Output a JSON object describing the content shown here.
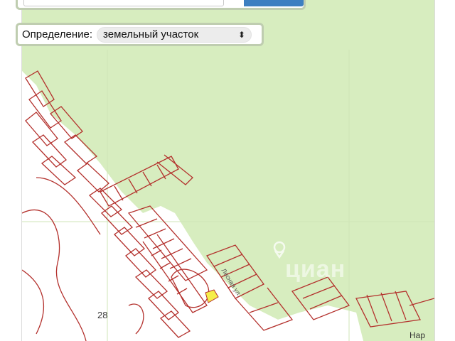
{
  "search": {
    "input_value": "",
    "button_label": ""
  },
  "definition": {
    "label": "Определение:",
    "selected": "земельный участок"
  },
  "map": {
    "parcel_number": "28",
    "street_label": "Лесная ул.",
    "town_label_partial": "Нар",
    "watermark": "циан"
  },
  "colors": {
    "forest": "#d7edbf",
    "parcel_outline": "#b3302c",
    "highlight_parcel": "#f5ee4a",
    "panel_border": "#bfcdb0",
    "search_button": "#3d7fc1"
  },
  "icons": [
    "chevron-updown-icon",
    "location-pin-icon"
  ]
}
